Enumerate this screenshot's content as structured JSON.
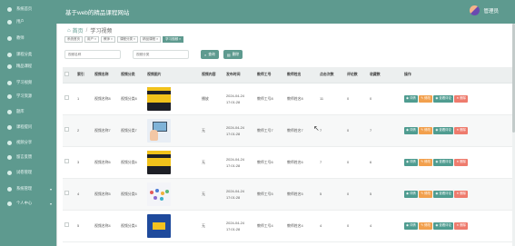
{
  "header": {
    "title": "基于web的精品课程网站",
    "user_name": "管理员"
  },
  "sidebar": {
    "items": [
      {
        "label": "系统首页",
        "icon": "home-icon"
      },
      {
        "label": "用户",
        "icon": "user-icon"
      },
      {
        "label": "教师",
        "icon": "teacher-icon"
      },
      {
        "label": "课程分类",
        "icon": "category-icon"
      },
      {
        "label": "精品课程",
        "icon": "course-icon"
      },
      {
        "label": "学习视频",
        "icon": "video-icon"
      },
      {
        "label": "学习资源",
        "icon": "resource-icon"
      },
      {
        "label": "题库",
        "icon": "question-bank-icon"
      },
      {
        "label": "课程提问",
        "icon": "question-icon"
      },
      {
        "label": "视频分享",
        "icon": "share-icon"
      },
      {
        "label": "留言反馈",
        "icon": "message-icon"
      },
      {
        "label": "试卷管理",
        "icon": "paper-icon"
      },
      {
        "label": "系统管理",
        "icon": "system-icon"
      },
      {
        "label": "个人中心",
        "icon": "person-icon"
      }
    ]
  },
  "breadcrumb": {
    "home": "首页",
    "current": "学习视频"
  },
  "tags": [
    "系统首页",
    "用户 ×",
    "教师 ×",
    "课程分类 ×",
    "精品课程 ×",
    "学习视频 ×"
  ],
  "search": {
    "name_placeholder": "视频名称",
    "category_placeholder": "视频分类",
    "search_button": "查询",
    "delete_button": "删除"
  },
  "table": {
    "columns": [
      "",
      "索引",
      "视频名称",
      "视频分类",
      "视频图片",
      "视频内容",
      "发布时间",
      "教师工号",
      "教师姓名",
      "点击次数",
      "评论数",
      "收藏数",
      "操作"
    ],
    "rows": [
      {
        "index": "1",
        "name": "视频名称8",
        "category": "视频分类8",
        "image": "book-cover",
        "content": "播放",
        "time": "2024-04-24 17:01:28",
        "teacher_no": "教师工号8",
        "teacher_name": "教师姓名8",
        "clicks": "11",
        "comments": "0",
        "favorites": "0"
      },
      {
        "index": "2",
        "name": "视频名称7",
        "category": "视频分类7",
        "image": "computer-illustration",
        "content": "无",
        "time": "2024-04-24 17:01:28",
        "teacher_no": "教师工号7",
        "teacher_name": "教师姓名7",
        "clicks": "7",
        "comments": "0",
        "favorites": "7"
      },
      {
        "index": "3",
        "name": "视频名称6",
        "category": "视频分类6",
        "image": "book-cover",
        "content": "无",
        "time": "2024-04-24 17:01:28",
        "teacher_no": "教师工号6",
        "teacher_name": "教师姓名6",
        "clicks": "7",
        "comments": "0",
        "favorites": "6"
      },
      {
        "index": "4",
        "name": "视频名称5",
        "category": "视频分类5",
        "image": "dots-illustration",
        "content": "无",
        "time": "2024-04-24 17:01:28",
        "teacher_no": "教师工号5",
        "teacher_name": "教师姓名5",
        "clicks": "5",
        "comments": "0",
        "favorites": "5"
      },
      {
        "index": "5",
        "name": "视频名称4",
        "category": "视频分类4",
        "image": "blue-cover",
        "content": "无",
        "time": "2024-04-24 17:01:28",
        "teacher_no": "教师工号4",
        "teacher_name": "教师姓名4",
        "clicks": "4",
        "comments": "0",
        "favorites": "4"
      }
    ],
    "actions": [
      {
        "label": "详情",
        "icon": "eye-icon",
        "color": "#4f9c90"
      },
      {
        "label": "修改",
        "icon": "edit-icon",
        "color": "#f2a04d"
      },
      {
        "label": "查看评论",
        "icon": "comment-icon",
        "color": "#4f9c90"
      },
      {
        "label": "删除",
        "icon": "trash-icon",
        "color": "#ee7b6d"
      }
    ]
  },
  "colors": {
    "primary": "#5e9a8f",
    "orange": "#f2a04d",
    "red": "#ee7b6d",
    "green_text": "#5aa86a"
  }
}
